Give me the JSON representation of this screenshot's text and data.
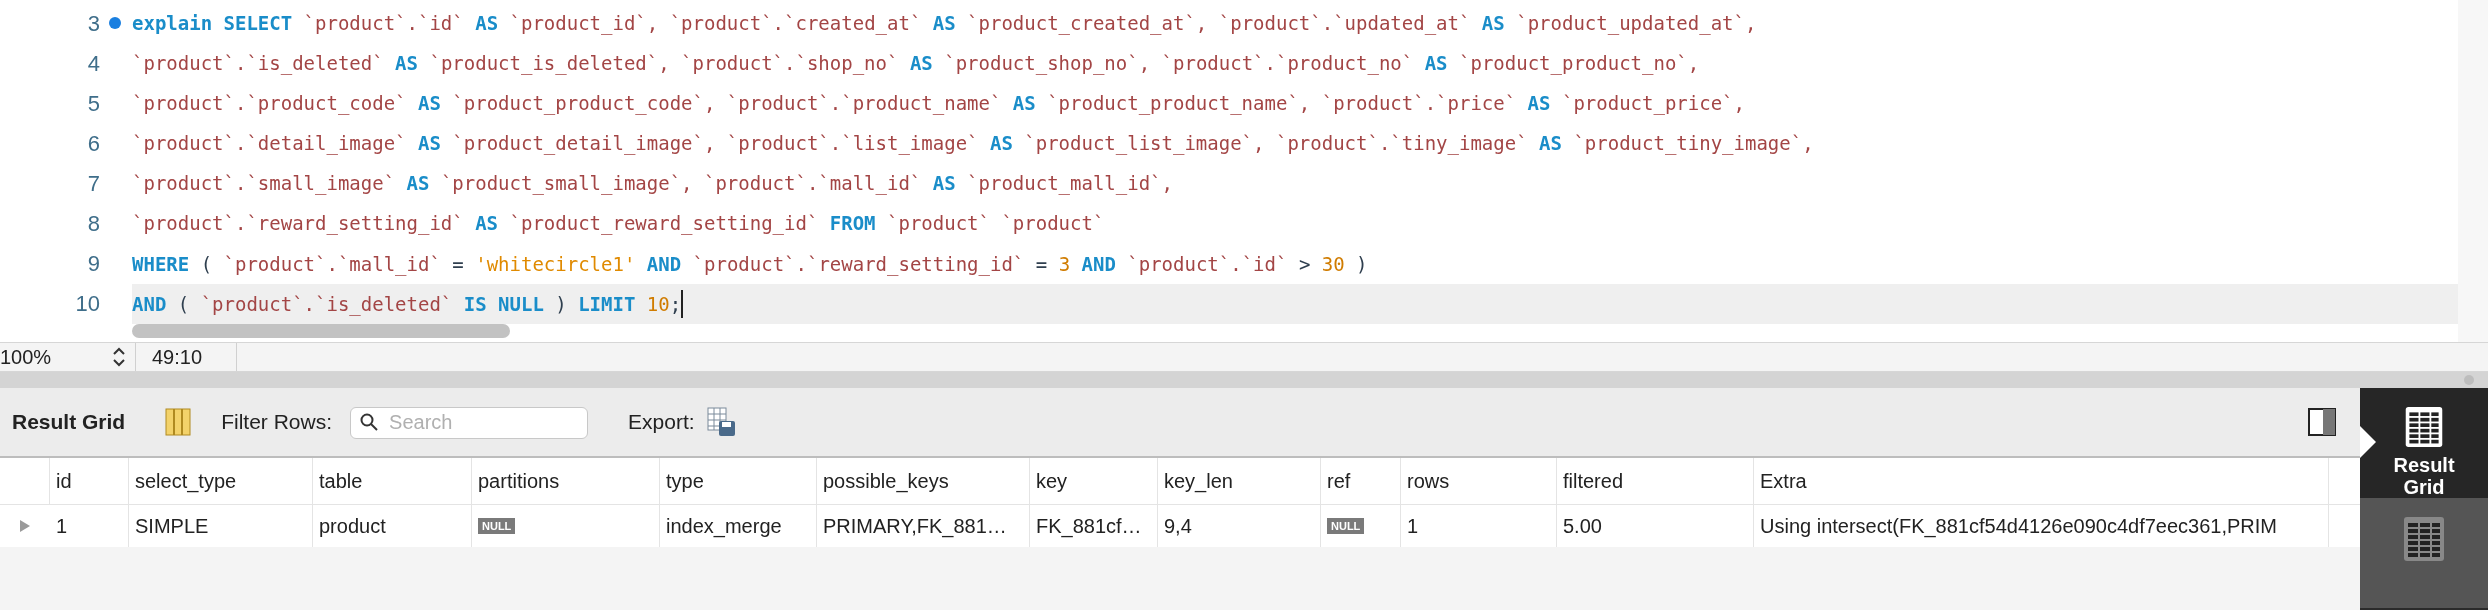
{
  "editor": {
    "lines": [
      {
        "number": "3",
        "marked": true,
        "current": false,
        "tokens": [
          {
            "kind": "keyword",
            "text": "explain SELECT"
          },
          {
            "kind": "ident",
            "text": " `product`.`id` "
          },
          {
            "kind": "keyword",
            "text": "AS"
          },
          {
            "kind": "ident",
            "text": " `product_id`, `product`.`created_at` "
          },
          {
            "kind": "keyword",
            "text": "AS"
          },
          {
            "kind": "ident",
            "text": " `product_created_at`, `product`.`updated_at` "
          },
          {
            "kind": "keyword",
            "text": "AS"
          },
          {
            "kind": "ident",
            "text": " `product_updated_at`,"
          }
        ]
      },
      {
        "number": "4",
        "marked": false,
        "current": false,
        "tokens": [
          {
            "kind": "ident",
            "text": "`product`.`is_deleted` "
          },
          {
            "kind": "keyword",
            "text": "AS"
          },
          {
            "kind": "ident",
            "text": " `product_is_deleted`, `product`.`shop_no` "
          },
          {
            "kind": "keyword",
            "text": "AS"
          },
          {
            "kind": "ident",
            "text": " `product_shop_no`, `product`.`product_no` "
          },
          {
            "kind": "keyword",
            "text": "AS"
          },
          {
            "kind": "ident",
            "text": " `product_product_no`,"
          }
        ]
      },
      {
        "number": "5",
        "marked": false,
        "current": false,
        "tokens": [
          {
            "kind": "ident",
            "text": "`product`.`product_code` "
          },
          {
            "kind": "keyword",
            "text": "AS"
          },
          {
            "kind": "ident",
            "text": " `product_product_code`, `product`.`product_name` "
          },
          {
            "kind": "keyword",
            "text": "AS"
          },
          {
            "kind": "ident",
            "text": " `product_product_name`, `product`.`price` "
          },
          {
            "kind": "keyword",
            "text": "AS"
          },
          {
            "kind": "ident",
            "text": " `product_price`,"
          }
        ]
      },
      {
        "number": "6",
        "marked": false,
        "current": false,
        "tokens": [
          {
            "kind": "ident",
            "text": "`product`.`detail_image` "
          },
          {
            "kind": "keyword",
            "text": "AS"
          },
          {
            "kind": "ident",
            "text": " `product_detail_image`, `product`.`list_image` "
          },
          {
            "kind": "keyword",
            "text": "AS"
          },
          {
            "kind": "ident",
            "text": " `product_list_image`, `product`.`tiny_image` "
          },
          {
            "kind": "keyword",
            "text": "AS"
          },
          {
            "kind": "ident",
            "text": " `product_tiny_image`,"
          }
        ]
      },
      {
        "number": "7",
        "marked": false,
        "current": false,
        "tokens": [
          {
            "kind": "ident",
            "text": "`product`.`small_image` "
          },
          {
            "kind": "keyword",
            "text": "AS"
          },
          {
            "kind": "ident",
            "text": " `product_small_image`, `product`.`mall_id` "
          },
          {
            "kind": "keyword",
            "text": "AS"
          },
          {
            "kind": "ident",
            "text": " `product_mall_id`,"
          }
        ]
      },
      {
        "number": "8",
        "marked": false,
        "current": false,
        "tokens": [
          {
            "kind": "ident",
            "text": "`product`.`reward_setting_id` "
          },
          {
            "kind": "keyword",
            "text": "AS"
          },
          {
            "kind": "ident",
            "text": " `product_reward_setting_id` "
          },
          {
            "kind": "keyword",
            "text": "FROM"
          },
          {
            "kind": "ident",
            "text": " `product` `product`"
          }
        ]
      },
      {
        "number": "9",
        "marked": false,
        "current": false,
        "tokens": [
          {
            "kind": "keyword",
            "text": "WHERE"
          },
          {
            "kind": "op",
            "text": " ( "
          },
          {
            "kind": "ident",
            "text": "`product`.`mall_id`"
          },
          {
            "kind": "op",
            "text": " = "
          },
          {
            "kind": "string",
            "text": "'whitecircle1'"
          },
          {
            "kind": "keyword",
            "text": " AND "
          },
          {
            "kind": "ident",
            "text": "`product`.`reward_setting_id`"
          },
          {
            "kind": "op",
            "text": " = "
          },
          {
            "kind": "number",
            "text": "3"
          },
          {
            "kind": "keyword",
            "text": " AND "
          },
          {
            "kind": "ident",
            "text": "`product`.`id`"
          },
          {
            "kind": "op",
            "text": " > "
          },
          {
            "kind": "number",
            "text": "30"
          },
          {
            "kind": "op",
            "text": " )"
          }
        ]
      },
      {
        "number": "10",
        "marked": false,
        "current": true,
        "tokens": [
          {
            "kind": "keyword",
            "text": "AND"
          },
          {
            "kind": "op",
            "text": " ( "
          },
          {
            "kind": "ident",
            "text": "`product`.`is_deleted`"
          },
          {
            "kind": "keyword",
            "text": " IS NULL "
          },
          {
            "kind": "op",
            "text": ")"
          },
          {
            "kind": "keyword",
            "text": " LIMIT "
          },
          {
            "kind": "number",
            "text": "10"
          },
          {
            "kind": "op",
            "text": ";"
          }
        ]
      }
    ]
  },
  "status_bar": {
    "zoom": "100%",
    "position": "49:10"
  },
  "toolbar": {
    "title": "Result Grid",
    "filter_label": "Filter Rows:",
    "search": {
      "placeholder": "Search"
    },
    "export_label": "Export:"
  },
  "table": {
    "columns": [
      "id",
      "select_type",
      "table",
      "partitions",
      "type",
      "possible_keys",
      "key",
      "key_len",
      "ref",
      "rows",
      "filtered",
      "Extra"
    ],
    "rows": [
      {
        "cells": [
          {
            "kind": "text",
            "text": "1"
          },
          {
            "kind": "text",
            "text": "SIMPLE"
          },
          {
            "kind": "text",
            "text": "product"
          },
          {
            "kind": "null",
            "text": "NULL"
          },
          {
            "kind": "text",
            "text": "index_merge"
          },
          {
            "kind": "text",
            "text": "PRIMARY,FK_881…"
          },
          {
            "kind": "text",
            "text": "FK_881cf…"
          },
          {
            "kind": "text",
            "text": "9,4"
          },
          {
            "kind": "null",
            "text": "NULL"
          },
          {
            "kind": "text",
            "text": "1"
          },
          {
            "kind": "text",
            "text": "5.00"
          },
          {
            "kind": "text",
            "text": "Using intersect(FK_881cf54d4126e090c4df7eec361,PRIM"
          }
        ]
      }
    ]
  },
  "side_tabs": [
    {
      "label": "Result Grid",
      "selected": true
    },
    {
      "selected": false
    }
  ]
}
